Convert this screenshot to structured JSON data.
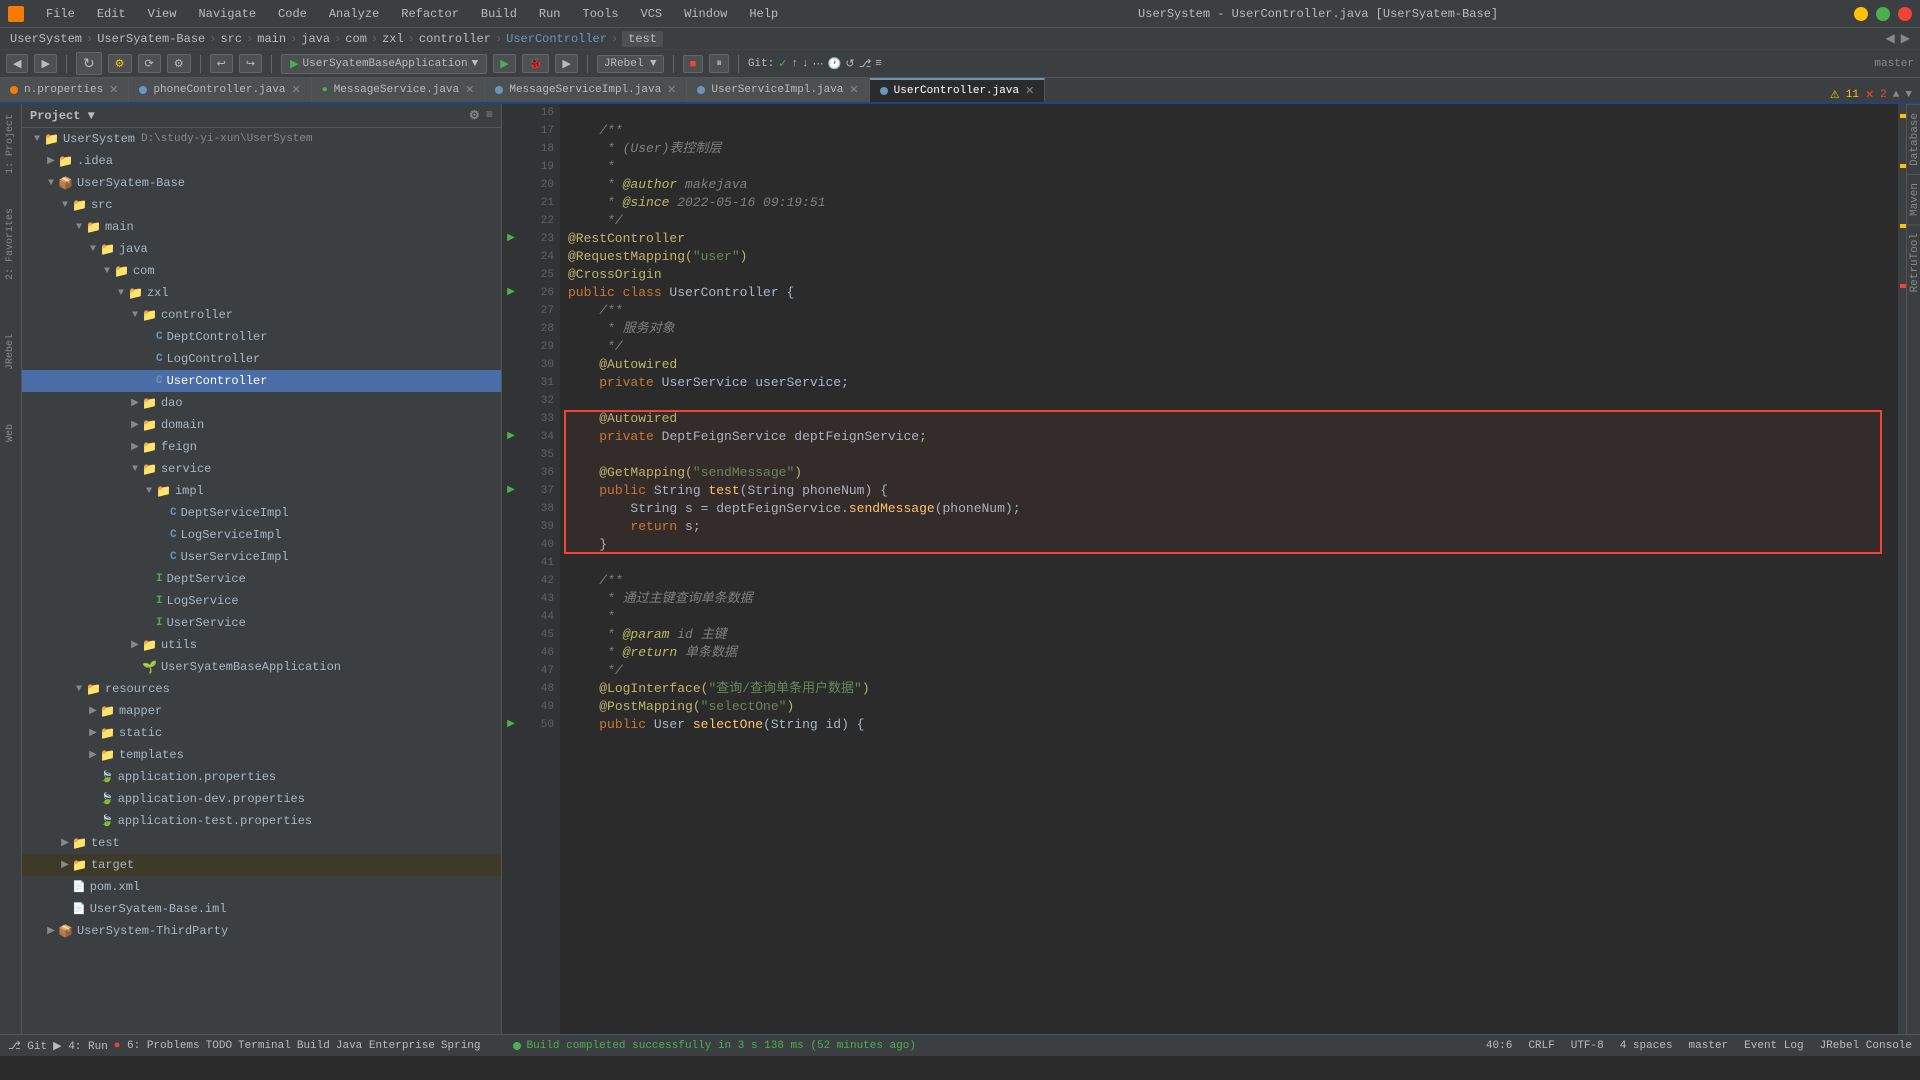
{
  "titlebar": {
    "title": "UserSystem - UserController.java [UserSyatem-Base]",
    "menu_items": [
      "File",
      "Edit",
      "View",
      "Navigate",
      "Code",
      "Analyze",
      "Refactor",
      "Build",
      "Run",
      "Tools",
      "VCS",
      "Window",
      "Help"
    ]
  },
  "breadcrumb": {
    "items": [
      "UserSystem",
      "UserSyatem-Base",
      "src",
      "main",
      "java",
      "com",
      "zxl",
      "controller",
      "UserController"
    ],
    "tabs": [
      "test"
    ]
  },
  "toolbar": {
    "run_config": "UserSyatemBaseApplication",
    "jrebel_label": "JRebel",
    "git_label": "Git:",
    "master_label": "master"
  },
  "tabs": [
    {
      "label": "n.properties",
      "type": "props",
      "closable": true
    },
    {
      "label": "phoneController.java",
      "type": "java",
      "closable": true
    },
    {
      "label": "MessageService.java",
      "type": "interface",
      "closable": true
    },
    {
      "label": "MessageServiceImpl.java",
      "type": "java",
      "closable": true
    },
    {
      "label": "UserServiceImpl.java",
      "type": "java",
      "closable": true
    },
    {
      "label": "UserController.java",
      "type": "java",
      "active": true,
      "closable": true
    }
  ],
  "project_tree": {
    "title": "Project",
    "items": [
      {
        "id": "usersystem-root",
        "label": "UserSystem",
        "path": "D:\\study-yi-xun\\UserSystem",
        "level": 0,
        "type": "root",
        "expanded": true
      },
      {
        "id": "idea",
        "label": ".idea",
        "level": 1,
        "type": "folder",
        "expanded": false
      },
      {
        "id": "usersyatem-base",
        "label": "UserSyatem-Base",
        "level": 1,
        "type": "module",
        "expanded": true
      },
      {
        "id": "src",
        "label": "src",
        "level": 2,
        "type": "folder",
        "expanded": true
      },
      {
        "id": "main",
        "label": "main",
        "level": 3,
        "type": "folder",
        "expanded": true
      },
      {
        "id": "java",
        "label": "java",
        "level": 4,
        "type": "folder",
        "expanded": true
      },
      {
        "id": "com",
        "label": "com",
        "level": 5,
        "type": "folder",
        "expanded": true
      },
      {
        "id": "zxl",
        "label": "zxl",
        "level": 6,
        "type": "folder",
        "expanded": true
      },
      {
        "id": "controller",
        "label": "controller",
        "level": 7,
        "type": "folder",
        "expanded": true
      },
      {
        "id": "deptcontroller",
        "label": "DeptController",
        "level": 8,
        "type": "java",
        "expanded": false
      },
      {
        "id": "logcontroller",
        "label": "LogController",
        "level": 8,
        "type": "java",
        "expanded": false
      },
      {
        "id": "usercontroller",
        "label": "UserController",
        "level": 8,
        "type": "java",
        "selected": true,
        "expanded": false
      },
      {
        "id": "dao",
        "label": "dao",
        "level": 7,
        "type": "folder",
        "expanded": false
      },
      {
        "id": "domain",
        "label": "domain",
        "level": 7,
        "type": "folder",
        "expanded": false
      },
      {
        "id": "feign",
        "label": "feign",
        "level": 7,
        "type": "folder",
        "expanded": false
      },
      {
        "id": "service",
        "label": "service",
        "level": 7,
        "type": "folder",
        "expanded": true
      },
      {
        "id": "impl",
        "label": "impl",
        "level": 8,
        "type": "folder",
        "expanded": true
      },
      {
        "id": "deptserviceimpl",
        "label": "DeptServiceImpl",
        "level": 9,
        "type": "java",
        "expanded": false
      },
      {
        "id": "logserviceimpl",
        "label": "LogServiceImpl",
        "level": 9,
        "type": "java",
        "expanded": false
      },
      {
        "id": "userserviceimpl",
        "label": "UserServiceImpl",
        "level": 9,
        "type": "java",
        "expanded": false
      },
      {
        "id": "deptservice",
        "label": "DeptService",
        "level": 8,
        "type": "interface",
        "expanded": false
      },
      {
        "id": "logservice",
        "label": "LogService",
        "level": 8,
        "type": "interface",
        "expanded": false
      },
      {
        "id": "userservice",
        "label": "UserService",
        "level": 8,
        "type": "interface",
        "expanded": false
      },
      {
        "id": "utils",
        "label": "utils",
        "level": 7,
        "type": "folder",
        "expanded": false
      },
      {
        "id": "usersyatembaseapp",
        "label": "UserSyatemBaseApplication",
        "level": 7,
        "type": "spring",
        "expanded": false
      },
      {
        "id": "resources",
        "label": "resources",
        "level": 3,
        "type": "folder",
        "expanded": true
      },
      {
        "id": "mapper",
        "label": "mapper",
        "level": 4,
        "type": "folder",
        "expanded": false
      },
      {
        "id": "static",
        "label": "static",
        "level": 4,
        "type": "folder",
        "expanded": false
      },
      {
        "id": "templates",
        "label": "templates",
        "level": 4,
        "type": "folder",
        "expanded": false
      },
      {
        "id": "app-props",
        "label": "application.properties",
        "level": 4,
        "type": "props",
        "expanded": false
      },
      {
        "id": "app-dev-props",
        "label": "application-dev.properties",
        "level": 4,
        "type": "props",
        "expanded": false
      },
      {
        "id": "app-test-props",
        "label": "application-test.properties",
        "level": 4,
        "type": "props",
        "expanded": false
      },
      {
        "id": "test",
        "label": "test",
        "level": 2,
        "type": "folder",
        "expanded": false
      },
      {
        "id": "target",
        "label": "target",
        "level": 2,
        "type": "folder-yellow",
        "expanded": false
      },
      {
        "id": "pom",
        "label": "pom.xml",
        "level": 2,
        "type": "pom",
        "expanded": false
      },
      {
        "id": "iml",
        "label": "UserSyatem-Base.iml",
        "level": 2,
        "type": "iml",
        "expanded": false
      },
      {
        "id": "usersystem-thirdparty",
        "label": "UserSystem-ThirdParty",
        "level": 1,
        "type": "module",
        "expanded": false
      }
    ]
  },
  "code": {
    "filename": "UserController.java",
    "lines": [
      {
        "num": 16,
        "content": ""
      },
      {
        "num": 17,
        "content": "    /**"
      },
      {
        "num": 18,
        "content": "     * (User)表控制层"
      },
      {
        "num": 19,
        "content": "     *"
      },
      {
        "num": 20,
        "content": "     * @author makejava"
      },
      {
        "num": 21,
        "content": "     * @since 2022-05-16 09:19:51"
      },
      {
        "num": 22,
        "content": "     */"
      },
      {
        "num": 23,
        "content": "@RestController",
        "gutter": "green"
      },
      {
        "num": 24,
        "content": "@RequestMapping(\"user\")"
      },
      {
        "num": 25,
        "content": "@CrossOrigin"
      },
      {
        "num": 26,
        "content": "public class UserController {",
        "gutter": "green"
      },
      {
        "num": 27,
        "content": "    /**"
      },
      {
        "num": 28,
        "content": "     * 服务对象"
      },
      {
        "num": 29,
        "content": "     */"
      },
      {
        "num": 30,
        "content": "    @Autowired"
      },
      {
        "num": 31,
        "content": "    private UserService userService;"
      },
      {
        "num": 32,
        "content": ""
      },
      {
        "num": 33,
        "content": "    @Autowired",
        "box_start": true
      },
      {
        "num": 34,
        "content": "    private DeptFeignService deptFeignService;",
        "gutter": "green"
      },
      {
        "num": 35,
        "content": ""
      },
      {
        "num": 36,
        "content": "    @GetMapping(\"sendMessage\")"
      },
      {
        "num": 37,
        "content": "    public String test(String phoneNum) {",
        "gutter": "green"
      },
      {
        "num": 38,
        "content": "        String s = deptFeignService.sendMessage(phoneNum);"
      },
      {
        "num": 39,
        "content": "        return s;"
      },
      {
        "num": 40,
        "content": "    }",
        "box_end": true
      },
      {
        "num": 41,
        "content": ""
      },
      {
        "num": 42,
        "content": "    /**"
      },
      {
        "num": 43,
        "content": "     * 通过主键查询单条数据"
      },
      {
        "num": 44,
        "content": "     *"
      },
      {
        "num": 45,
        "content": "     * @param id 主键"
      },
      {
        "num": 46,
        "content": "     * @return 单条数据"
      },
      {
        "num": 47,
        "content": "     */"
      },
      {
        "num": 48,
        "content": "    @LogInterface(\"查询/查询单条用户数据\")"
      },
      {
        "num": 49,
        "content": "    @PostMapping(\"selectOne\")"
      },
      {
        "num": 50,
        "content": "    public User selectOne(String id) {",
        "gutter": "green"
      }
    ]
  },
  "statusbar": {
    "git": "Git",
    "run": "4: Run",
    "problems": "6: Problems",
    "todo": "TODO",
    "terminal": "Terminal",
    "build": "Build",
    "java_enterprise": "Java Enterprise",
    "spring": "Spring",
    "position": "40:6",
    "encoding": "CRLF",
    "charset": "UTF-8",
    "indent": "4 spaces",
    "branch": "master",
    "event_log": "Event Log",
    "jrebel_console": "JRebel Console",
    "build_message": "Build completed successfully in 3 s 138 ms (52 minutes ago)"
  },
  "warnings": {
    "count": "11",
    "errors": "2"
  },
  "right_panel_tabs": [
    "Database",
    "Maven",
    "RetruTool"
  ],
  "left_panel_tabs": [
    "1: Project",
    "2: Favorites",
    "JRebel",
    "Web"
  ]
}
